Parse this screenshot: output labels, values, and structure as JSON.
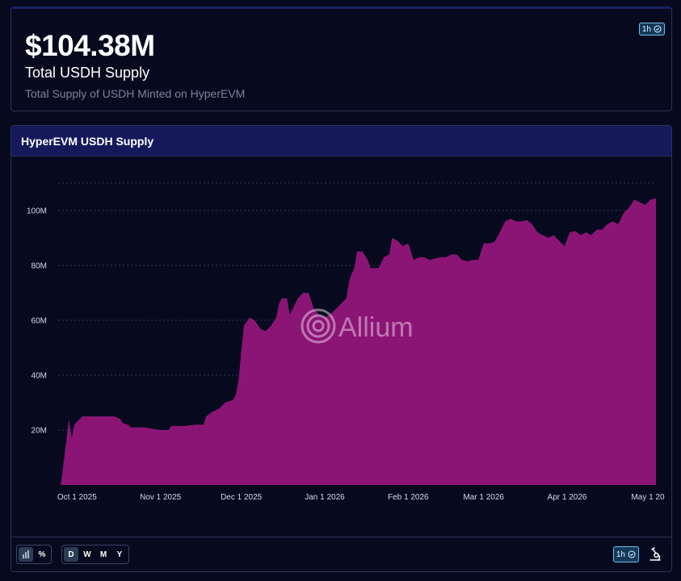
{
  "stat": {
    "value": "$104.38M",
    "title": "Total USDH Supply",
    "subtitle": "Total Supply of USDH Minted on HyperEVM",
    "refresh": "1h"
  },
  "chart_card": {
    "title": "HyperEVM USDH Supply",
    "watermark": "Allium"
  },
  "footer": {
    "view_toggles": [
      {
        "name": "bar-chart-icon",
        "label": "",
        "active": true
      },
      {
        "name": "percent-toggle",
        "label": "%",
        "active": false
      }
    ],
    "period_toggles": [
      {
        "label": "D",
        "active": true
      },
      {
        "label": "W",
        "active": false
      },
      {
        "label": "M",
        "active": false
      },
      {
        "label": "Y",
        "active": false
      }
    ],
    "refresh": "1h"
  },
  "colors": {
    "area": "#8b1575",
    "grid": "#2e3450",
    "header_bg": "#15195c",
    "badge_border": "#6ec3e6"
  },
  "chart_data": {
    "type": "area",
    "title": "HyperEVM USDH Supply",
    "xlabel": "",
    "ylabel": "",
    "grid": true,
    "legend": "none",
    "unit": "M USD",
    "ylim": [
      0,
      112
    ],
    "y_ticks": [
      20,
      40,
      60,
      80,
      100
    ],
    "y_tick_labels": [
      "20M",
      "40M",
      "60M",
      "80M",
      "100M"
    ],
    "x_ticks": [
      "2025-10-01",
      "2025-11-01",
      "2025-12-01",
      "2026-01-01",
      "2026-02-01",
      "2026-03-01",
      "2026-04-01",
      "2026-05-01"
    ],
    "x_tick_labels": [
      "Oct 1 2025",
      "Nov 1 2025",
      "Dec 1 2025",
      "Jan 1 2026",
      "Feb 1 2026",
      "Mar 1 2026",
      "Apr 1 2026",
      "May 1 20"
    ],
    "xlim": [
      "2025-09-24",
      "2026-05-04"
    ],
    "series": [
      {
        "points": [
          [
            "2025-09-24",
            0
          ],
          [
            "2025-09-25",
            0
          ],
          [
            "2025-09-26",
            8
          ],
          [
            "2025-09-27",
            16
          ],
          [
            "2025-09-28",
            24
          ],
          [
            "2025-09-29",
            17
          ],
          [
            "2025-09-30",
            22
          ],
          [
            "2025-10-01",
            23
          ],
          [
            "2025-10-02",
            24
          ],
          [
            "2025-10-03",
            25
          ],
          [
            "2025-10-08",
            25
          ],
          [
            "2025-10-12",
            25
          ],
          [
            "2025-10-15",
            25
          ],
          [
            "2025-10-17",
            24
          ],
          [
            "2025-10-18",
            22.5
          ],
          [
            "2025-10-20",
            22
          ],
          [
            "2025-10-21",
            21
          ],
          [
            "2025-10-26",
            21
          ],
          [
            "2025-10-29",
            20.5
          ],
          [
            "2025-11-01",
            20
          ],
          [
            "2025-11-04",
            20
          ],
          [
            "2025-11-05",
            21.5
          ],
          [
            "2025-11-10",
            21.5
          ],
          [
            "2025-11-14",
            22
          ],
          [
            "2025-11-17",
            22
          ],
          [
            "2025-11-18",
            25
          ],
          [
            "2025-11-20",
            26.5
          ],
          [
            "2025-11-23",
            28
          ],
          [
            "2025-11-25",
            30
          ],
          [
            "2025-11-28",
            31
          ],
          [
            "2025-11-29",
            33
          ],
          [
            "2025-11-30",
            38
          ],
          [
            "2025-12-01",
            49
          ],
          [
            "2025-12-02",
            58
          ],
          [
            "2025-12-04",
            61
          ],
          [
            "2025-12-06",
            60
          ],
          [
            "2025-12-08",
            57
          ],
          [
            "2025-12-10",
            56
          ],
          [
            "2025-12-12",
            58
          ],
          [
            "2025-12-14",
            61
          ],
          [
            "2025-12-15",
            66
          ],
          [
            "2025-12-16",
            68
          ],
          [
            "2025-12-18",
            68
          ],
          [
            "2025-12-19",
            62
          ],
          [
            "2025-12-20",
            64
          ],
          [
            "2025-12-22",
            68
          ],
          [
            "2025-12-24",
            70
          ],
          [
            "2025-12-26",
            70
          ],
          [
            "2025-12-28",
            64
          ],
          [
            "2025-12-30",
            62
          ],
          [
            "2026-01-01",
            61
          ],
          [
            "2026-01-03",
            62
          ],
          [
            "2026-01-05",
            64
          ],
          [
            "2026-01-07",
            66
          ],
          [
            "2026-01-09",
            68
          ],
          [
            "2026-01-10",
            74
          ],
          [
            "2026-01-11",
            77
          ],
          [
            "2026-01-12",
            79
          ],
          [
            "2026-01-13",
            85
          ],
          [
            "2026-01-15",
            85
          ],
          [
            "2026-01-17",
            82
          ],
          [
            "2026-01-18",
            79
          ],
          [
            "2026-01-21",
            79
          ],
          [
            "2026-01-23",
            83
          ],
          [
            "2026-01-25",
            84
          ],
          [
            "2026-01-26",
            90
          ],
          [
            "2026-01-28",
            89
          ],
          [
            "2026-01-30",
            87
          ],
          [
            "2026-02-01",
            88
          ],
          [
            "2026-02-03",
            82
          ],
          [
            "2026-02-05",
            83
          ],
          [
            "2026-02-07",
            83
          ],
          [
            "2026-02-09",
            82
          ],
          [
            "2026-02-11",
            82.5
          ],
          [
            "2026-02-13",
            83
          ],
          [
            "2026-02-15",
            83
          ],
          [
            "2026-02-17",
            84
          ],
          [
            "2026-02-19",
            84
          ],
          [
            "2026-02-21",
            82
          ],
          [
            "2026-02-23",
            81.5
          ],
          [
            "2026-02-25",
            82
          ],
          [
            "2026-02-27",
            82
          ],
          [
            "2026-03-01",
            88
          ],
          [
            "2026-03-03",
            88
          ],
          [
            "2026-03-05",
            88.5
          ],
          [
            "2026-03-07",
            92
          ],
          [
            "2026-03-09",
            96
          ],
          [
            "2026-03-11",
            97
          ],
          [
            "2026-03-13",
            96
          ],
          [
            "2026-03-15",
            96
          ],
          [
            "2026-03-17",
            96.5
          ],
          [
            "2026-03-19",
            95
          ],
          [
            "2026-03-21",
            92
          ],
          [
            "2026-03-23",
            91
          ],
          [
            "2026-03-25",
            90
          ],
          [
            "2026-03-27",
            91
          ],
          [
            "2026-03-29",
            89
          ],
          [
            "2026-03-31",
            87
          ],
          [
            "2026-04-02",
            92
          ],
          [
            "2026-04-04",
            92.5
          ],
          [
            "2026-04-06",
            91
          ],
          [
            "2026-04-08",
            92
          ],
          [
            "2026-04-10",
            91
          ],
          [
            "2026-04-12",
            93
          ],
          [
            "2026-04-14",
            93
          ],
          [
            "2026-04-16",
            95
          ],
          [
            "2026-04-18",
            96
          ],
          [
            "2026-04-20",
            95
          ],
          [
            "2026-04-22",
            99
          ],
          [
            "2026-04-24",
            101
          ],
          [
            "2026-04-26",
            104
          ],
          [
            "2026-04-28",
            103
          ],
          [
            "2026-04-30",
            102
          ],
          [
            "2026-05-02",
            104
          ],
          [
            "2026-05-04",
            104.38
          ]
        ]
      }
    ]
  }
}
